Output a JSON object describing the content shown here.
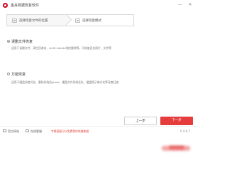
{
  "app": {
    "title": "金舟数据恢复软件"
  },
  "window_controls": {
    "minimize": "—",
    "close": "✕"
  },
  "steps": [
    {
      "label": "选择恢复文件的位置",
      "icon": "folder-icon"
    },
    {
      "label": "选择恢复模式",
      "icon": "mode-icon"
    }
  ],
  "options": [
    {
      "title": "误删文件恢复",
      "description": "适用于误删文件、清空回收站、shift+delete彻底删除等，可恢复丢失照片、文件等",
      "selected": true
    },
    {
      "title": "万能恢复",
      "description": "适用于硬盘误格式化、重装系统误ghost、硬盘文件系统丢失、硬盘提示格式化等深度扫描",
      "selected": false
    }
  ],
  "buttons": {
    "prev": "上一步",
    "next": "下一步"
  },
  "footer": {
    "home": "官方网站",
    "service": "在线客服",
    "promo": "专属客服可以免费帮你恢复数据",
    "version": "V 4.6.7"
  },
  "colors": {
    "accent": "#e73c3c",
    "brand": "#d0021b"
  }
}
